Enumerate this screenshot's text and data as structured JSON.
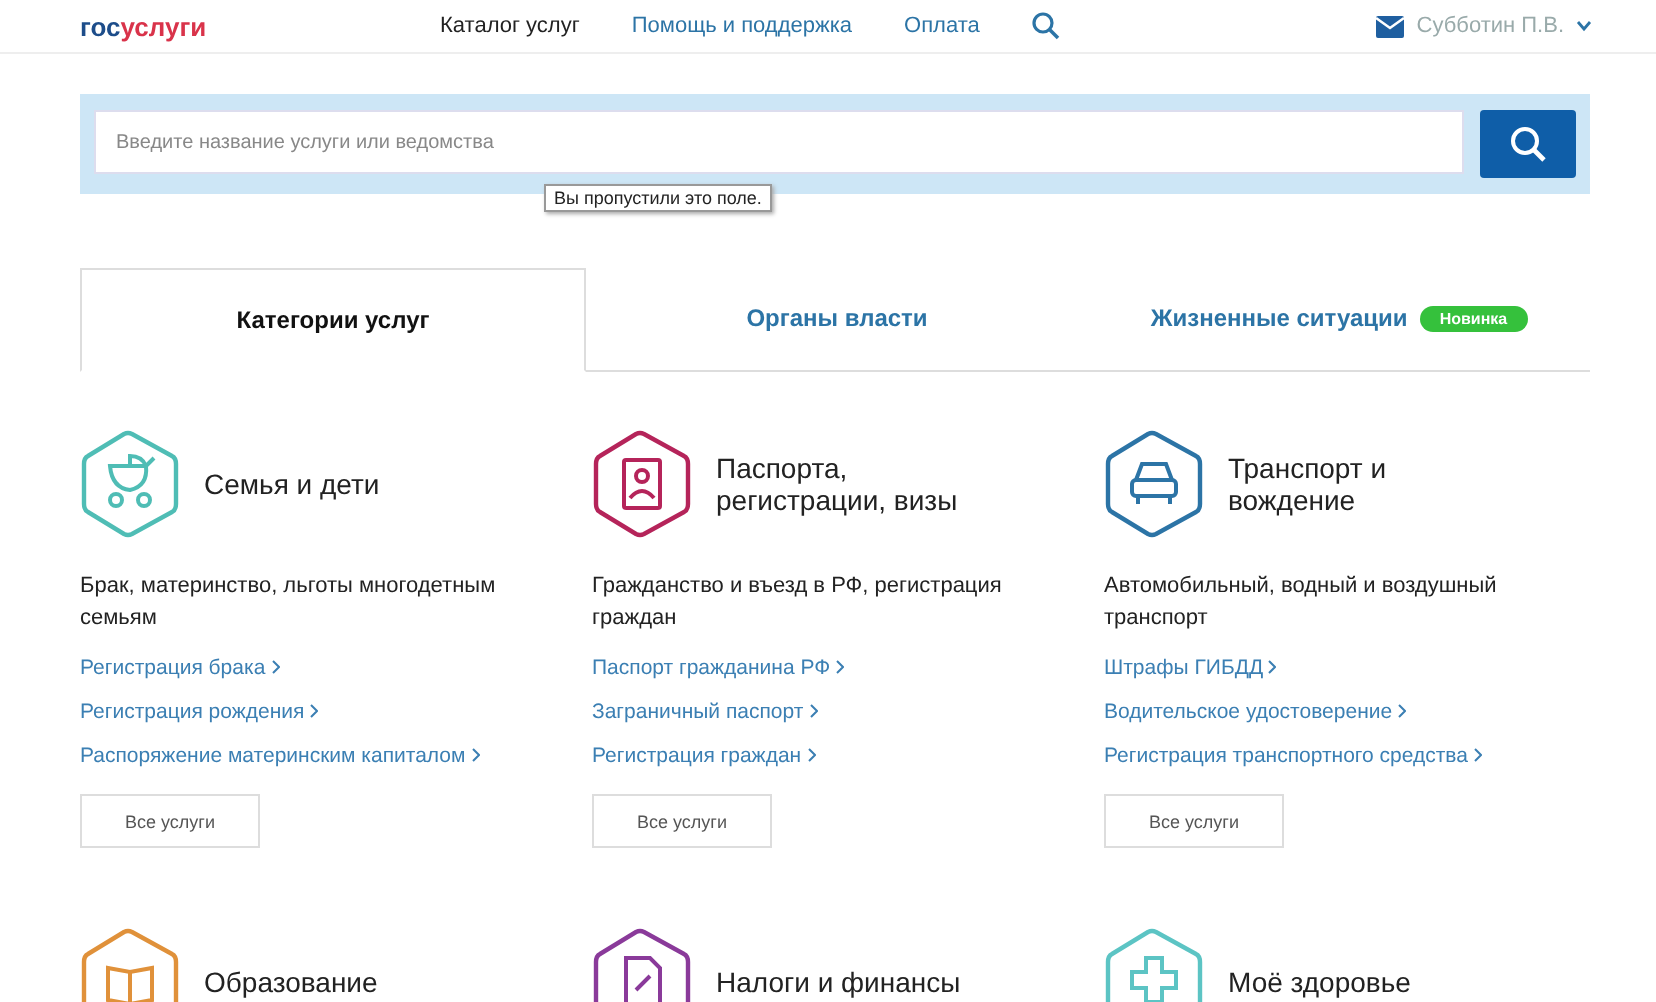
{
  "header": {
    "logo": {
      "part_1": "гос",
      "part_2": "услуги"
    },
    "nav": [
      {
        "label": "Каталог услуг",
        "selected": true
      },
      {
        "label": "Помощь и поддержка",
        "selected": false
      },
      {
        "label": "Оплата",
        "selected": false
      }
    ],
    "user": "Субботин П.В."
  },
  "search": {
    "placeholder": "Введите название услуги или ведомства",
    "tooltip": "Вы пропустили это поле."
  },
  "tabs": [
    {
      "label": "Категории услуг",
      "selected": true
    },
    {
      "label": "Органы власти",
      "selected": false
    },
    {
      "label": "Жизненные ситуации",
      "selected": false,
      "badge": "Новинка"
    }
  ],
  "categories": [
    {
      "kind": "stroller",
      "color": "#4fbdb5",
      "title": "Семья и дети",
      "description": "Брак, материнство, льготы многодетным семьям",
      "links": [
        "Регистрация брака",
        "Регистрация рождения",
        "Распоряжение материнским капиталом"
      ],
      "button": "Все услуги"
    },
    {
      "kind": "passport",
      "color": "#b5245a",
      "title": "Паспорта, регистрации, визы",
      "description": "Гражданство и въезд в РФ, регистрация граждан",
      "links": [
        "Паспорт гражданина РФ",
        "Заграничный паспорт",
        "Регистрация граждан"
      ],
      "button": "Все услуги"
    },
    {
      "kind": "car",
      "color": "#2c74a6",
      "title": "Транспорт и вождение",
      "description": "Автомобильный, водный и воздушный транспорт",
      "links": [
        "Штрафы ГИБДД",
        "Водительское удостоверение",
        "Регистрация транспортного средства"
      ],
      "button": "Все услуги"
    },
    {
      "kind": "book",
      "color": "#e0913a",
      "title": "Образование"
    },
    {
      "kind": "document",
      "color": "#8a3a9a",
      "title": "Налоги и финансы"
    },
    {
      "kind": "cross",
      "color": "#5cc4c4",
      "title": "Моё здоровье"
    }
  ]
}
